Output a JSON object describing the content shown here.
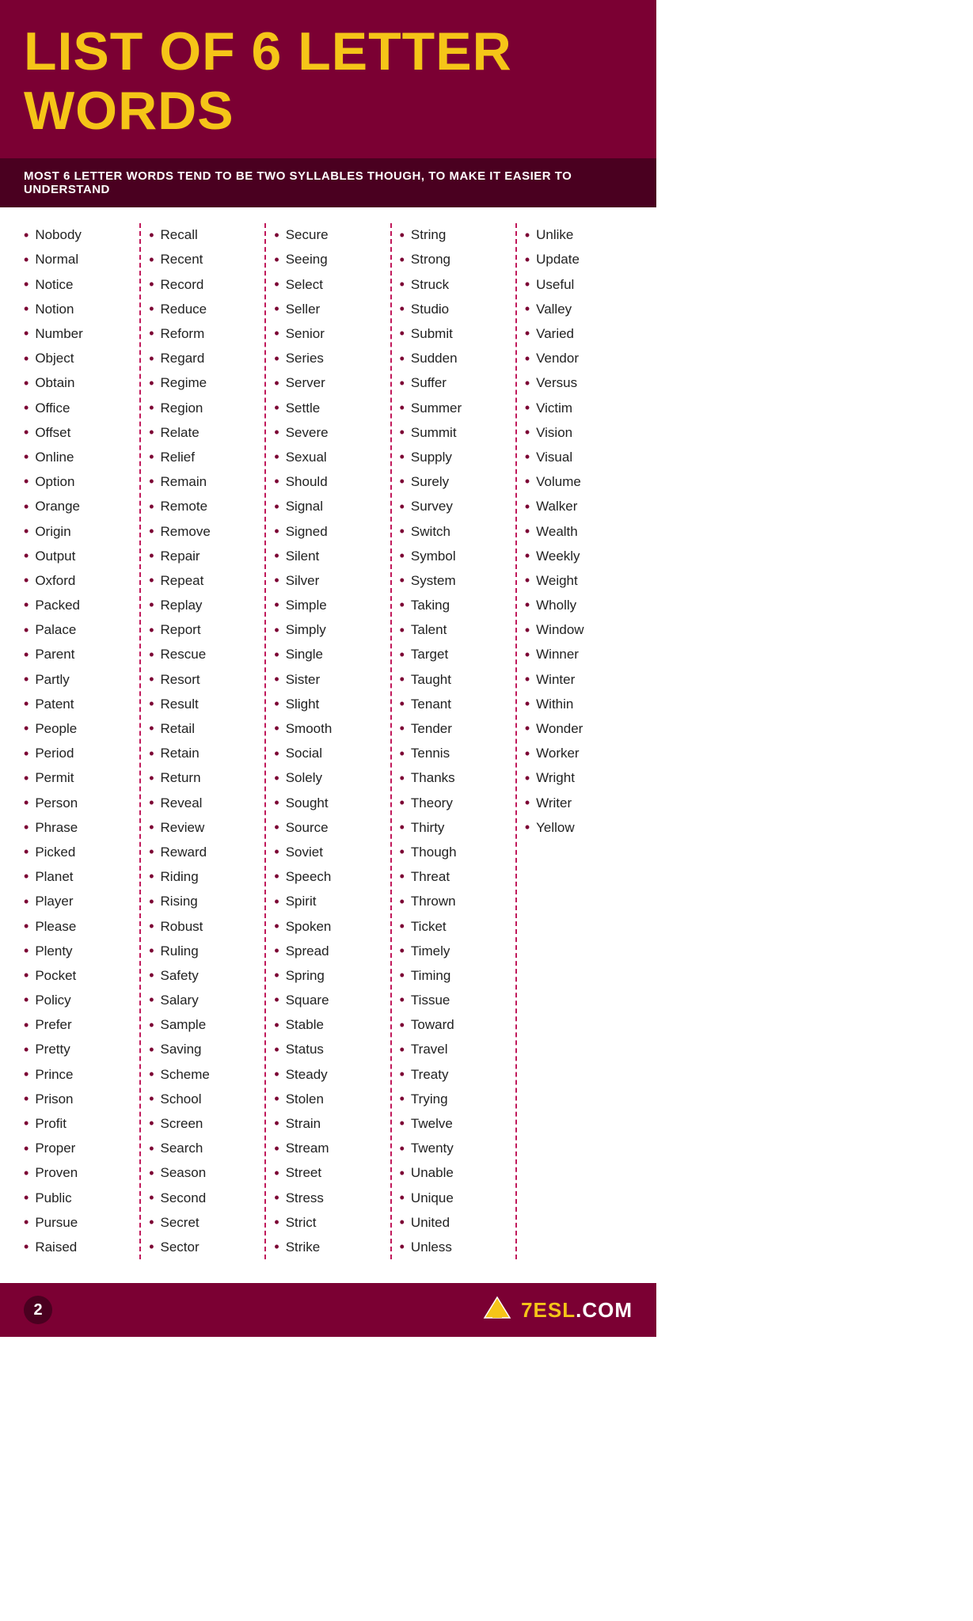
{
  "header": {
    "title": "LIST OF 6 LETTER WORDS",
    "subtitle": "MOST 6 LETTER WORDS TEND TO BE TWO SYLLABLES THOUGH, TO MAKE IT EASIER TO UNDERSTAND"
  },
  "columns": [
    {
      "words": [
        "Nobody",
        "Normal",
        "Notice",
        "Notion",
        "Number",
        "Object",
        "Obtain",
        "Office",
        "Offset",
        "Online",
        "Option",
        "Orange",
        "Origin",
        "Output",
        "Oxford",
        "Packed",
        "Palace",
        "Parent",
        "Partly",
        "Patent",
        "People",
        "Period",
        "Permit",
        "Person",
        "Phrase",
        "Picked",
        "Planet",
        "Player",
        "Please",
        "Plenty",
        "Pocket",
        "Policy",
        "Prefer",
        "Pretty",
        "Prince",
        "Prison",
        "Profit",
        "Proper",
        "Proven",
        "Public",
        "Pursue",
        "Raised"
      ]
    },
    {
      "words": [
        "Recall",
        "Recent",
        "Record",
        "Reduce",
        "Reform",
        "Regard",
        "Regime",
        "Region",
        "Relate",
        "Relief",
        "Remain",
        "Remote",
        "Remove",
        "Repair",
        "Repeat",
        "Replay",
        "Report",
        "Rescue",
        "Resort",
        "Result",
        "Retail",
        "Retain",
        "Return",
        "Reveal",
        "Review",
        "Reward",
        "Riding",
        "Rising",
        "Robust",
        "Ruling",
        "Safety",
        "Salary",
        "Sample",
        "Saving",
        "Scheme",
        "School",
        "Screen",
        "Search",
        "Season",
        "Second",
        "Secret",
        "Sector"
      ]
    },
    {
      "words": [
        "Secure",
        "Seeing",
        "Select",
        "Seller",
        "Senior",
        "Series",
        "Server",
        "Settle",
        "Severe",
        "Sexual",
        "Should",
        "Signal",
        "Signed",
        "Silent",
        "Silver",
        "Simple",
        "Simply",
        "Single",
        "Sister",
        "Slight",
        "Smooth",
        "Social",
        "Solely",
        "Sought",
        "Source",
        "Soviet",
        "Speech",
        "Spirit",
        "Spoken",
        "Spread",
        "Spring",
        "Square",
        "Stable",
        "Status",
        "Steady",
        "Stolen",
        "Strain",
        "Stream",
        "Street",
        "Stress",
        "Strict",
        "Strike"
      ]
    },
    {
      "words": [
        "String",
        "Strong",
        "Struck",
        "Studio",
        "Submit",
        "Sudden",
        "Suffer",
        "Summer",
        "Summit",
        "Supply",
        "Surely",
        "Survey",
        "Switch",
        "Symbol",
        "System",
        "Taking",
        "Talent",
        "Target",
        "Taught",
        "Tenant",
        "Tender",
        "Tennis",
        "Thanks",
        "Theory",
        "Thirty",
        "Though",
        "Threat",
        "Thrown",
        "Ticket",
        "Timely",
        "Timing",
        "Tissue",
        "Toward",
        "Travel",
        "Treaty",
        "Trying",
        "Twelve",
        "Twenty",
        "Unable",
        "Unique",
        "United",
        "Unless"
      ]
    },
    {
      "words": [
        "Unlike",
        "Update",
        "Useful",
        "Valley",
        "Varied",
        "Vendor",
        "Versus",
        "Victim",
        "Vision",
        "Visual",
        "Volume",
        "Walker",
        "Wealth",
        "Weekly",
        "Weight",
        "Wholly",
        "Window",
        "Winner",
        "Winter",
        "Within",
        "Wonder",
        "Worker",
        "Wright",
        "Writer",
        "Yellow"
      ]
    }
  ],
  "footer": {
    "page_number": "2",
    "logo_text": "7ESL.COM",
    "logo_highlight": "7ESL"
  }
}
